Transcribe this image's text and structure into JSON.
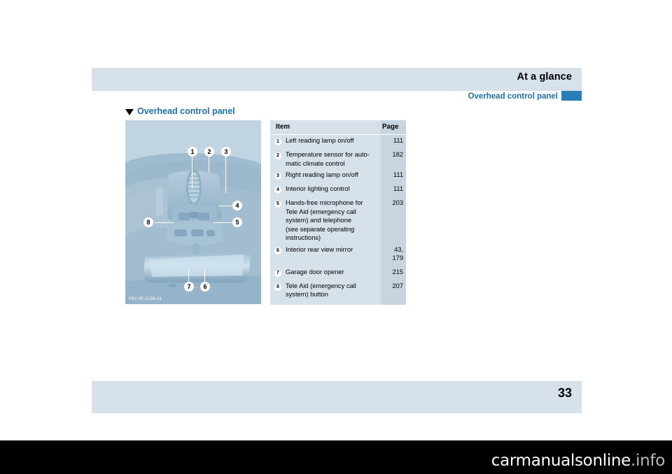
{
  "header": {
    "title": "At a glance",
    "subtitle": "Overhead control panel",
    "page_number": "33"
  },
  "section": {
    "marker": "triangle-marker",
    "heading": "Overhead control panel"
  },
  "photo": {
    "caption": "P82.00-2226-31",
    "callouts": [
      "1",
      "2",
      "3",
      "4",
      "5",
      "6",
      "7",
      "8"
    ]
  },
  "table": {
    "columns": [
      "Item",
      "Page"
    ],
    "rows": [
      {
        "num": "1",
        "label": "Left reading lamp on/off",
        "page": "111"
      },
      {
        "num": "2",
        "label": "Temperature sensor for auto-\nmatic climate control",
        "page": "182"
      },
      {
        "num": "3",
        "label": "Right reading lamp on/off",
        "page": "111"
      },
      {
        "num": "4",
        "label": "Interior lighting control",
        "page": "111"
      },
      {
        "num": "5",
        "label": "Hands-free microphone for\nTele Aid (emergency call\nsystem) and telephone\n(see separate operating\ninstructions)",
        "page": "203"
      },
      {
        "num": "6",
        "label": "Interior rear view mirror",
        "page": "43,\n179"
      },
      {
        "num": "7",
        "label": "Garage door opener",
        "page": "215"
      },
      {
        "num": "8",
        "label": "Tele Aid (emergency call\nsystem) button",
        "page": "207"
      }
    ]
  },
  "watermark": {
    "text_main": "carmanualsonline",
    "text_dim": ".info"
  },
  "colors": {
    "band": "#d7e1ea",
    "accent": "#1f6fa8",
    "tab": "#2a7fb8",
    "page_bg": "#ffffff",
    "outer_bg": "#000000"
  }
}
